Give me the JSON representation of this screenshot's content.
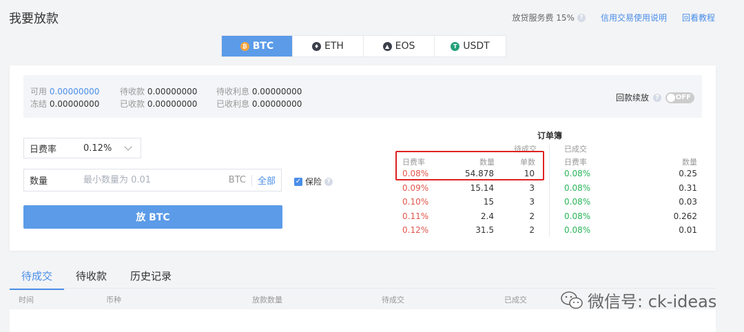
{
  "header": {
    "title": "我要放款",
    "fee_label": "放贷服务费 15%",
    "link_guide": "信用交易使用说明",
    "link_tutorial": "回看教程"
  },
  "coin_tabs": [
    {
      "label": "BTC",
      "icon": "btc-icon",
      "active": true,
      "color": "#f7a33b"
    },
    {
      "label": "ETH",
      "icon": "eth-icon",
      "active": false,
      "color": "#3a3f4b"
    },
    {
      "label": "EOS",
      "icon": "eos-icon",
      "active": false,
      "color": "#3a3f4b"
    },
    {
      "label": "USDT",
      "icon": "usdt-icon",
      "active": false,
      "color": "#26a17b"
    }
  ],
  "account": {
    "available_label": "可用",
    "available_value": "0.00000000",
    "frozen_label": "冻结",
    "frozen_value": "0.00000000",
    "pending_receive_label": "待收款",
    "pending_receive_value": "0.00000000",
    "received_label": "已收款",
    "received_value": "0.00000000",
    "pending_interest_label": "待收利息",
    "pending_interest_value": "0.00000000",
    "received_interest_label": "已收利息",
    "received_interest_value": "0.00000000"
  },
  "auto_renew": {
    "label": "回款续放",
    "state": "OFF"
  },
  "form": {
    "rate_label": "日费率",
    "rate_value": "0.12%",
    "qty_label": "数量",
    "qty_placeholder": "最小数量为 0.01",
    "qty_unit": "BTC",
    "qty_all": "全部",
    "insurance_label": "保险",
    "submit_label": "放 BTC"
  },
  "orderbook": {
    "title": "订单簿",
    "pending_title": "待成交",
    "filled_title": "已成交",
    "pending_headers": [
      "日费率",
      "数量",
      "单数"
    ],
    "filled_headers": [
      "日费率",
      "数量"
    ],
    "pending_rows": [
      {
        "rate": "0.08%",
        "qty": "54.878",
        "count": "10"
      },
      {
        "rate": "0.09%",
        "qty": "15.14",
        "count": "3"
      },
      {
        "rate": "0.10%",
        "qty": "15",
        "count": "3"
      },
      {
        "rate": "0.11%",
        "qty": "2.4",
        "count": "2"
      },
      {
        "rate": "0.12%",
        "qty": "31.5",
        "count": "2"
      }
    ],
    "filled_rows": [
      {
        "rate": "0.08%",
        "qty": "0.25"
      },
      {
        "rate": "0.08%",
        "qty": "0.31"
      },
      {
        "rate": "0.08%",
        "qty": "0.03"
      },
      {
        "rate": "0.08%",
        "qty": "0.262"
      },
      {
        "rate": "0.08%",
        "qty": "0.01"
      }
    ]
  },
  "bottom_tabs": [
    {
      "label": "待成交",
      "active": true
    },
    {
      "label": "待收款",
      "active": false
    },
    {
      "label": "历史记录",
      "active": false
    }
  ],
  "table_headers": [
    "时间",
    "币种",
    "放款数量",
    "待成交",
    "已成交"
  ],
  "watermark": "微信号: ck-ideas",
  "colors": {
    "accent": "#5b9be8",
    "link": "#4a8ee8",
    "red": "#e2564d",
    "green": "#29b45a"
  }
}
